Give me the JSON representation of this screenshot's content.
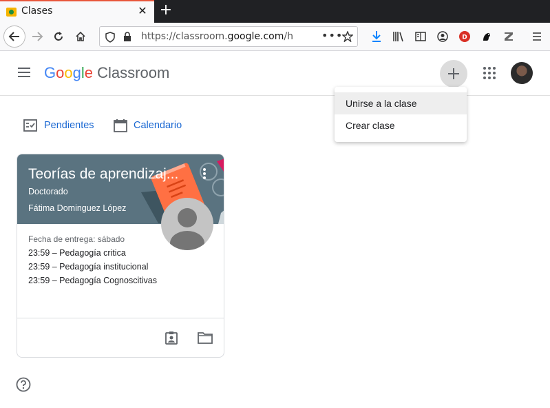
{
  "browser": {
    "tab_title": "Clases",
    "url_prefix": "https://classroom.",
    "url_domain": "google.com",
    "url_suffix": "/h"
  },
  "app": {
    "brand_product": "Classroom",
    "brand_google_letters": [
      "G",
      "o",
      "o",
      "g",
      "l",
      "e"
    ],
    "brand_colors": [
      "#4285f4",
      "#ea4335",
      "#fbbc05",
      "#4285f4",
      "#34a853",
      "#ea4335"
    ]
  },
  "menu": {
    "items": [
      {
        "label": "Unirse a la clase"
      },
      {
        "label": "Crear clase"
      }
    ]
  },
  "subnav": {
    "pending_label": "Pendientes",
    "calendar_label": "Calendario"
  },
  "card": {
    "title": "Teorías de aprendizaj...",
    "section": "Doctorado",
    "teacher": "Fátima Dominguez López",
    "due_label": "Fecha de entrega: sábado",
    "assignments": [
      "23:59 – Pedagogía critica",
      "23:59 – Pedagogía institucional",
      "23:59 – Pedagogía Cognoscitivas"
    ],
    "banner_color": "#5a7380"
  },
  "colors": {
    "accent": "#1967d2",
    "tab_accent": "#e8573c"
  }
}
